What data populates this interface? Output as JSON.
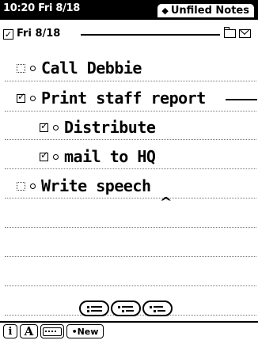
{
  "status_bar": {
    "time_date": "10:20 Fri 8/18",
    "folder_tab_label": "Unfiled Notes"
  },
  "note_header": {
    "date": "Fri 8/18"
  },
  "checklist": [
    {
      "text": "Call Debbie",
      "checked": false,
      "level": 0
    },
    {
      "text": "Print staff report",
      "checked": true,
      "level": 0
    },
    {
      "text": "Distribute",
      "checked": true,
      "level": 1
    },
    {
      "text": "mail to HQ",
      "checked": true,
      "level": 1
    },
    {
      "text": "Write speech",
      "checked": false,
      "level": 0
    }
  ],
  "toolbar": {
    "info_label": "i",
    "abc_label": "A",
    "new_label": "•New"
  },
  "icons": {
    "folder": "folder-icon",
    "mail": "mail-icon",
    "keyboard": "keyboard-icon"
  }
}
